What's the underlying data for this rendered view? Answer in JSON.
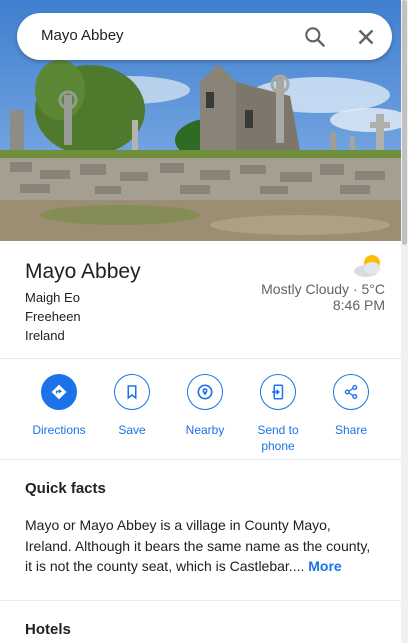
{
  "search": {
    "query": "Mayo Abbey"
  },
  "icons": {
    "search": "search-icon",
    "close": "close-icon",
    "weather": "partly-cloudy-icon"
  },
  "place": {
    "name": "Mayo Abbey",
    "address_lines": [
      "Maigh Eo",
      "Freeheen",
      "Ireland"
    ]
  },
  "weather": {
    "condition": "Mostly Cloudy · 5°C",
    "time": "8:46 PM"
  },
  "actions": [
    {
      "label_line1": "Directions",
      "label_line2": "",
      "icon": "directions-icon"
    },
    {
      "label_line1": "Save",
      "label_line2": "",
      "icon": "bookmark-icon"
    },
    {
      "label_line1": "Nearby",
      "label_line2": "",
      "icon": "nearby-icon"
    },
    {
      "label_line1": "Send to",
      "label_line2": "phone",
      "icon": "send-to-phone-icon"
    },
    {
      "label_line1": "Share",
      "label_line2": "",
      "icon": "share-icon"
    }
  ],
  "quick_facts": {
    "title": "Quick facts",
    "text": "Mayo or Mayo Abbey is a village in County Mayo, Ireland. Although it bears the same name as the county, it is not the county seat, which is Castlebar....",
    "more_label": "More"
  },
  "hotels": {
    "title": "Hotels"
  },
  "colors": {
    "accent": "#1a73e8",
    "muted_text": "#5f6368",
    "divider": "#e8eaed"
  }
}
